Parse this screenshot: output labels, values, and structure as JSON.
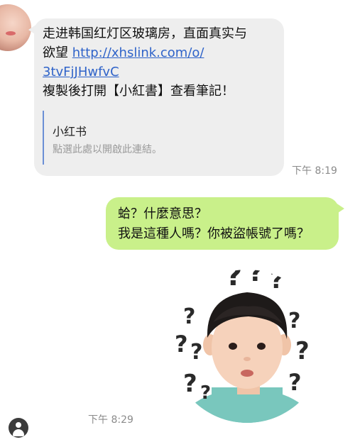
{
  "messages": {
    "incoming": {
      "line1": "走进韩国红灯区玻璃房，直面真实与",
      "line2_prefix": "欲望 ",
      "link_part1": "http://xhslink.com/o/",
      "link_part2": "3tvFjJHwfvC",
      "line4": "複製後打開【小紅書】查看筆記！",
      "preview_title": "小红书",
      "preview_desc": "點選此處以開啟此連結。",
      "time": "下午 8:19"
    },
    "outgoing": {
      "line1": "蛤？什麼意思？",
      "line2": "我是這種人嗎？你被盜帳號了嗎？"
    },
    "sticker": {
      "icon": "confused-boy-sticker",
      "time": "下午 8:29"
    }
  },
  "colors": {
    "incoming_bubble": "#eeeeee",
    "outgoing_bubble": "#c9f08a",
    "link": "#2f63c9",
    "preview_bar": "#6b8fd6",
    "timestamp": "#8b8b8b"
  }
}
